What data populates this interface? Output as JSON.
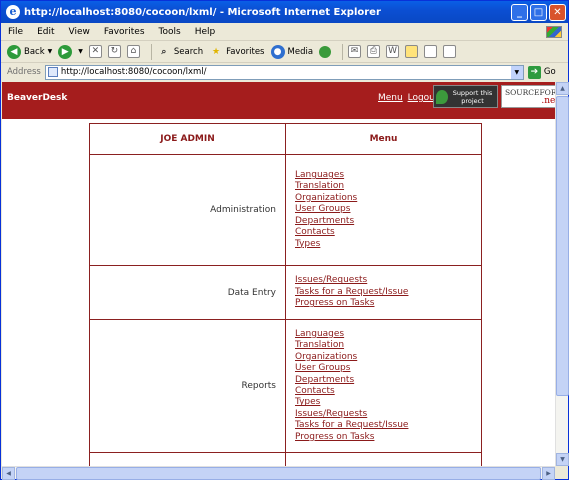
{
  "window": {
    "title": "http://localhost:8080/cocoon/lxml/ - Microsoft Internet Explorer",
    "minimize": "_",
    "maximize": "□",
    "close": "✕"
  },
  "menubar": {
    "items": [
      "File",
      "Edit",
      "View",
      "Favorites",
      "Tools",
      "Help"
    ]
  },
  "toolbar": {
    "back": "Back",
    "search": "Search",
    "favorites": "Favorites",
    "media": "Media"
  },
  "address": {
    "label": "Address",
    "url": "http://localhost:8080/cocoon/lxml/",
    "go": "Go"
  },
  "site": {
    "brand": "BeaverDesk",
    "menu_link": "Menu",
    "logout_link": "Logout",
    "support_text": "Support this project",
    "sf_logo_top": "SOURCEFORGE",
    "sf_logo_net": ".net"
  },
  "table": {
    "header_left": "JOE ADMIN",
    "header_right": "Menu",
    "sections": [
      {
        "label": "Administration",
        "links": [
          "Languages",
          "Translation",
          "Organizations",
          "User Groups",
          "Departments",
          "Contacts",
          "Types"
        ]
      },
      {
        "label": "Data Entry",
        "links": [
          "Issues/Requests",
          "Tasks for a Request/Issue",
          "Progress on Tasks"
        ]
      },
      {
        "label": "Reports",
        "links": [
          "Languages",
          "Translation",
          "Organizations",
          "User Groups",
          "Departments",
          "Contacts",
          "Types",
          "Issues/Requests",
          "Tasks for a Request/Issue",
          "Progress on Tasks"
        ]
      }
    ]
  },
  "colors": {
    "header_bg": "#a51d1d",
    "link": "#8b1a1a",
    "titlebar": "#0b4fd3"
  }
}
